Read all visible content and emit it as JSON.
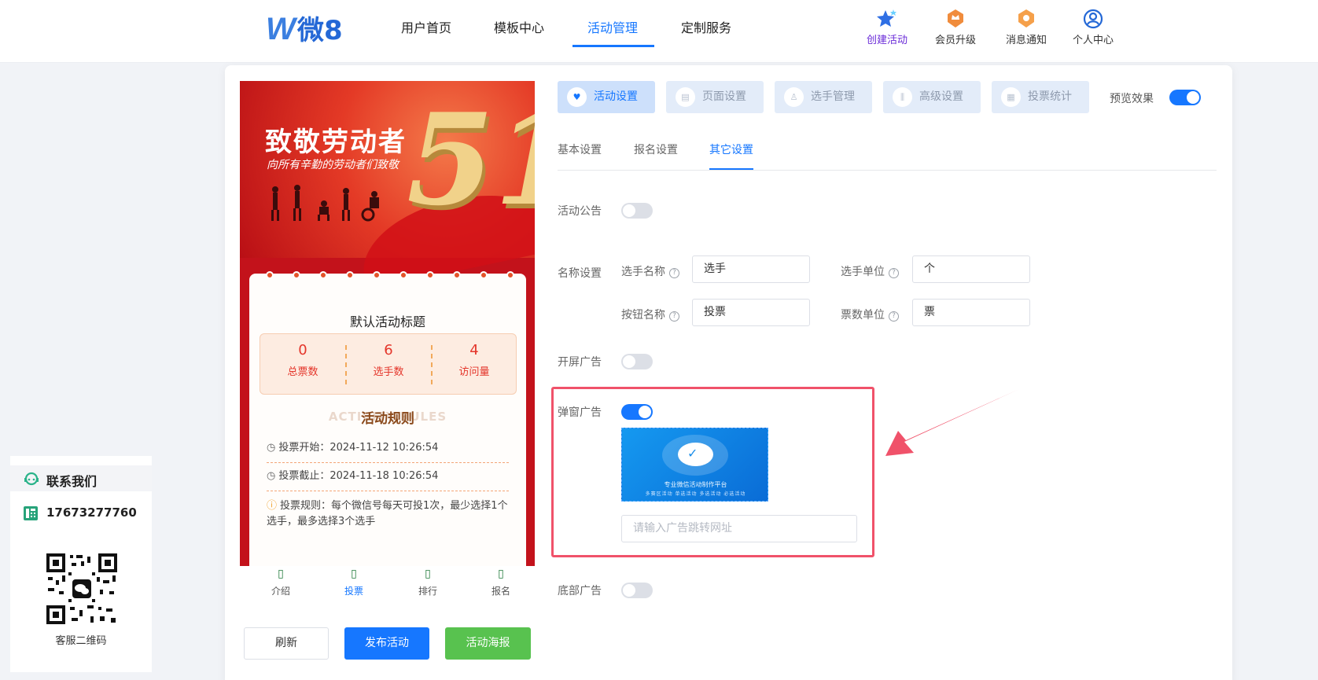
{
  "brand": {
    "logo_text": "微8",
    "logo_letter": "W"
  },
  "nav": {
    "items": [
      "用户首页",
      "模板中心",
      "活动管理",
      "定制服务"
    ],
    "active_index": 2
  },
  "top_actions": [
    {
      "label": "创建活动",
      "icon": "star-create-icon"
    },
    {
      "label": "会员升级",
      "icon": "crown-badge-icon"
    },
    {
      "label": "消息通知",
      "icon": "bell-badge-icon"
    },
    {
      "label": "个人中心",
      "icon": "user-circle-icon"
    }
  ],
  "preview": {
    "banner_title": "致敬劳动者",
    "banner_subtitle": "向所有辛勤的劳动者们致敬",
    "banner_number": "51",
    "activity_title": "默认活动标题",
    "stats": [
      {
        "value": "0",
        "label": "总票数"
      },
      {
        "value": "6",
        "label": "选手数"
      },
      {
        "value": "4",
        "label": "访问量"
      }
    ],
    "rules_bg_text": "ACTIVITY RULES",
    "rules_title": "活动规则",
    "rules": [
      {
        "label": "投票开始：",
        "value": "2024-11-12 10:26:54"
      },
      {
        "label": "投票截止：",
        "value": "2024-11-18 10:26:54"
      },
      {
        "label": "投票规则：",
        "value": "每个微信号每天可投1次，最少选择1个选手，最多选择3个选手"
      }
    ],
    "tabbar": [
      "介绍",
      "投票",
      "排行",
      "报名"
    ],
    "tabbar_active_index": 1
  },
  "buttons": {
    "refresh": "刷新",
    "publish": "发布活动",
    "poster": "活动海报"
  },
  "main_tabs": [
    "活动设置",
    "页面设置",
    "选手管理",
    "高级设置",
    "投票统计"
  ],
  "main_tab_active_index": 0,
  "preview_toggle": {
    "label": "预览效果",
    "on": true
  },
  "sub_tabs": [
    "基本设置",
    "报名设置",
    "其它设置"
  ],
  "sub_tab_active_index": 2,
  "form": {
    "announcement": {
      "label": "活动公告",
      "on": false
    },
    "naming": {
      "label": "名称设置",
      "player_name": {
        "label": "选手名称",
        "value": "选手"
      },
      "player_unit": {
        "label": "选手单位",
        "value": "个"
      },
      "button_name": {
        "label": "按钮名称",
        "value": "投票"
      },
      "vote_unit": {
        "label": "票数单位",
        "value": "票"
      }
    },
    "splash_ad": {
      "label": "开屏广告",
      "on": false
    },
    "popup_ad": {
      "label": "弹窗广告",
      "on": true,
      "image_caption": "专业微信活动制作平台",
      "image_sub": "多赛区活动  单选活动  多选活动  必选活动",
      "url_placeholder": "请输入广告跳转网址"
    },
    "bottom_ad": {
      "label": "底部广告",
      "on": false
    }
  },
  "contact": {
    "title": "联系我们",
    "phone": "17673277760",
    "qr_label": "客服二维码"
  },
  "colors": {
    "accent": "#1677ff",
    "highlight": "#f0526a",
    "green": "#58c24f",
    "stat_red": "#e4352a"
  }
}
